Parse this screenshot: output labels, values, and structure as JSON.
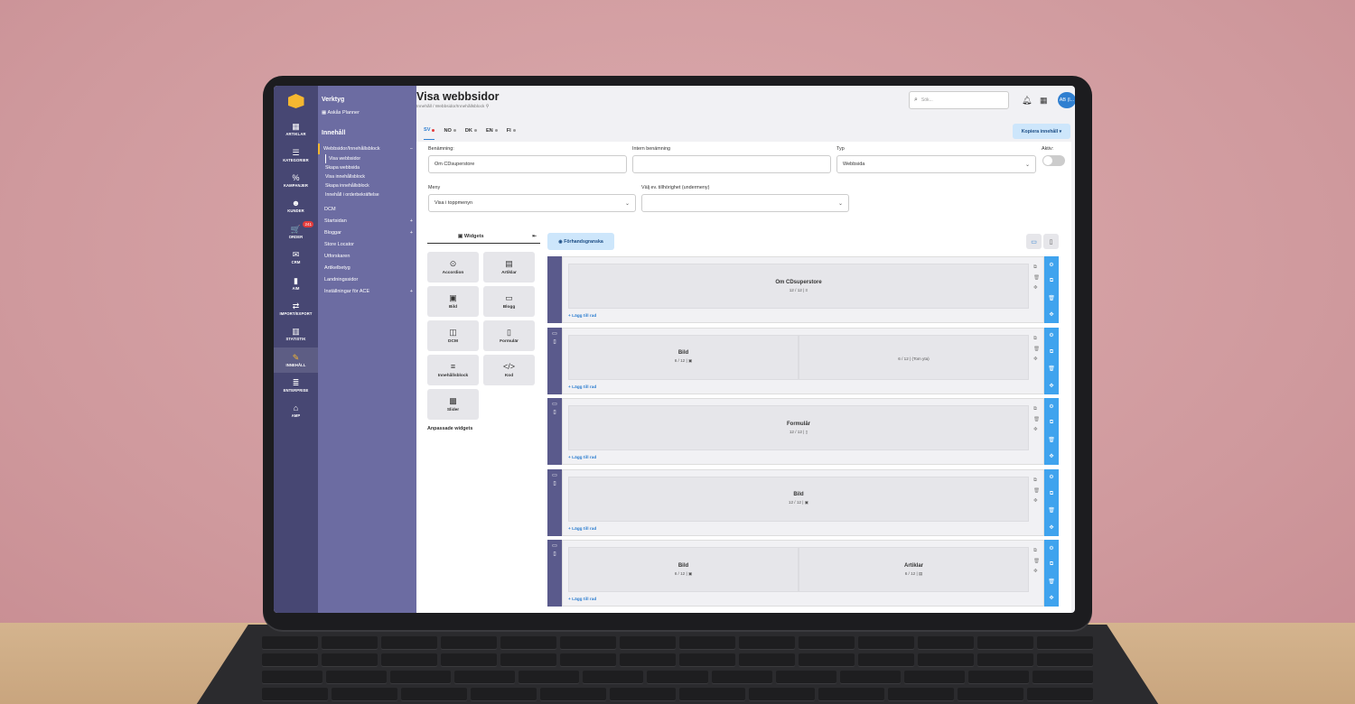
{
  "brand": {
    "accent": "#f5b730",
    "rail": "#474773",
    "nav": "#6c6ca2",
    "primary": "#3fa3ee"
  },
  "rail": [
    {
      "icon": "cubes-icon",
      "glyph": "▦",
      "label": "ARTIKLAR"
    },
    {
      "icon": "list-icon",
      "glyph": "☰",
      "label": "KATEGORIER"
    },
    {
      "icon": "percent-icon",
      "glyph": "%",
      "label": "KAMPANJER"
    },
    {
      "icon": "users-icon",
      "glyph": "☻",
      "label": "KUNDER"
    },
    {
      "icon": "cart-icon",
      "glyph": "🛒",
      "label": "ORDER",
      "badge": "241"
    },
    {
      "icon": "mail-icon",
      "glyph": "✉",
      "label": "CRM"
    },
    {
      "icon": "aim-icon",
      "glyph": "▮",
      "label": "AIM"
    },
    {
      "icon": "import-export-icon",
      "glyph": "⇄",
      "label": "IMPORT/EXPORT"
    },
    {
      "icon": "chart-icon",
      "glyph": "▥",
      "label": "STATISTIK"
    },
    {
      "icon": "edit-icon",
      "glyph": "✎",
      "label": "INNEHÅLL",
      "active": true
    },
    {
      "icon": "database-icon",
      "glyph": "≣",
      "label": "ENTERPRISE"
    },
    {
      "icon": "bank-icon",
      "glyph": "⌂",
      "label": "AMP"
    }
  ],
  "nav": {
    "tools_heading": "Verktyg",
    "tool_item": "Askås Planner",
    "content_heading": "Innehåll",
    "group": "Webbsidor/Innehållsblock",
    "group_toggle": "−",
    "subitems": [
      "Visa webbsidor",
      "Skapa webbsida",
      "Visa innehållsblock",
      "Skapa innehållsblock",
      "Innehåll i orderbekräftelse"
    ],
    "items": [
      {
        "label": "DCM",
        "plus": ""
      },
      {
        "label": "Startsidan",
        "plus": "+"
      },
      {
        "label": "Bloggar",
        "plus": "+"
      },
      {
        "label": "Store Locator",
        "plus": ""
      },
      {
        "label": "Utforskaren",
        "plus": ""
      },
      {
        "label": "Artikelbetyg",
        "plus": ""
      },
      {
        "label": "Landningssidor",
        "plus": ""
      },
      {
        "label": "Inställningar för ACE",
        "plus": "+"
      }
    ]
  },
  "header": {
    "title": "Visa webbsidor",
    "breadcrumb": "Innehåll / Webbsidor/Innehållsblock",
    "search_placeholder": "Sök...",
    "avatar": "AB (l..."
  },
  "languages": [
    "SV",
    "NO",
    "DK",
    "EN",
    "FI"
  ],
  "copy_button": "Kopiera innehåll ▾",
  "form": {
    "name_label": "Benämning:",
    "name_value": "Om CDsuperstore",
    "internal_label": "Intern benämning",
    "internal_value": "",
    "type_label": "Typ",
    "type_value": "Webbsida",
    "active_label": "Aktiv:",
    "menu_label": "Meny",
    "menu_value": "Visa i toppmenyn",
    "parent_label": "Välj ev. tillhörighet (undermeny)",
    "parent_value": ""
  },
  "widgets": {
    "tab": "Widgets",
    "collapse": "⇤",
    "items": [
      {
        "icon": "chevron-circle-icon",
        "glyph": "⊙",
        "label": "Accordion"
      },
      {
        "icon": "newspaper-icon",
        "glyph": "▤",
        "label": "Artiklar"
      },
      {
        "icon": "image-icon",
        "glyph": "▣",
        "label": "Bild"
      },
      {
        "icon": "blog-icon",
        "glyph": "▭",
        "label": "Blogg"
      },
      {
        "icon": "dcm-icon",
        "glyph": "◫",
        "label": "DCM"
      },
      {
        "icon": "clipboard-icon",
        "glyph": "▯",
        "label": "Formulär"
      },
      {
        "icon": "block-icon",
        "glyph": "≡",
        "label": "Innehållsblock"
      },
      {
        "icon": "code-icon",
        "glyph": "</>",
        "label": "Kod"
      },
      {
        "icon": "slider-icon",
        "glyph": "▩",
        "label": "Slider"
      }
    ],
    "custom": "Anpassade widgets"
  },
  "preview_button": "◉ Förhandsgranska",
  "add_row": "+ Lägg till rad",
  "rows": [
    {
      "cells": [
        {
          "title": "Om CDsuperstore",
          "meta": "12 / 12 | ≡"
        }
      ]
    },
    {
      "cells": [
        {
          "title": "Bild",
          "meta": "6 / 12 | ▣"
        },
        {
          "title": "",
          "meta": "6 / 12 | (Tom yta)"
        }
      ]
    },
    {
      "cells": [
        {
          "title": "Formulär",
          "meta": "12 / 12 | ▯"
        }
      ]
    },
    {
      "cells": [
        {
          "title": "Bild",
          "meta": "12 / 12 | ▣"
        }
      ]
    },
    {
      "cells": [
        {
          "title": "Bild",
          "meta": "6 / 12 | ▣"
        },
        {
          "title": "Artiklar",
          "meta": "6 / 12 | ▤"
        }
      ]
    }
  ]
}
